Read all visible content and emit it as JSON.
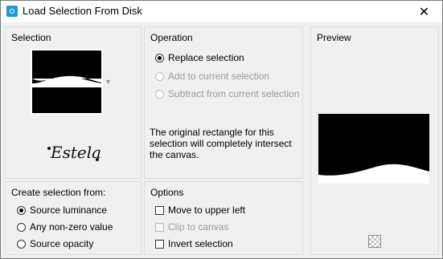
{
  "window": {
    "title": "Load Selection From Disk",
    "close_label": "✕"
  },
  "selection": {
    "title": "Selection",
    "signature_text": "Estela"
  },
  "operation": {
    "title": "Operation",
    "options": [
      {
        "label": "Replace selection",
        "checked": true,
        "enabled": true
      },
      {
        "label": "Add to current selection",
        "checked": false,
        "enabled": false
      },
      {
        "label": "Subtract from current selection",
        "checked": false,
        "enabled": false
      }
    ],
    "info_text": "The original rectangle for this selection will completely intersect the canvas."
  },
  "preview": {
    "title": "Preview"
  },
  "create_from": {
    "title": "Create selection from:",
    "options": [
      {
        "label": "Source luminance",
        "checked": true
      },
      {
        "label": "Any non-zero value",
        "checked": false
      },
      {
        "label": "Source opacity",
        "checked": false
      }
    ]
  },
  "options": {
    "title": "Options",
    "items": [
      {
        "label": "Move to upper left",
        "checked": false,
        "enabled": true
      },
      {
        "label": "Clip to canvas",
        "checked": false,
        "enabled": false
      },
      {
        "label": "Invert selection",
        "checked": false,
        "enabled": true
      }
    ]
  },
  "icons": {
    "app": "app-camera-icon",
    "dropdown": "chevron-down-icon",
    "transparency": "checkerboard-icon"
  }
}
